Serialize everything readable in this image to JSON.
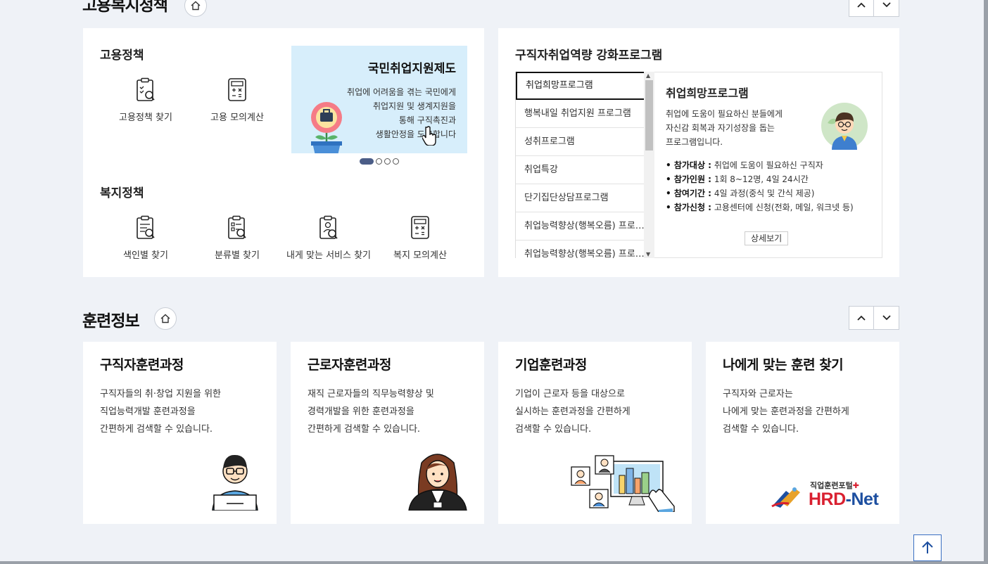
{
  "welfare_section": {
    "title": "고용복지정책",
    "employment": {
      "title": "고용정책",
      "items": [
        {
          "label": "고용정책 찾기",
          "icon": "clipboard-search-icon"
        },
        {
          "label": "고용 모의계산",
          "icon": "calculator-icon"
        }
      ],
      "banner": {
        "title": "국민취업지원제도",
        "lines": [
          "취업에 어려움을 겪는 국민에게",
          "취업지원 및 생계지원을",
          "통해 구직촉진과",
          "생활안정을 도모합니다"
        ],
        "slides": 4,
        "active_slide": 1
      }
    },
    "welfare": {
      "title": "복지정책",
      "items": [
        {
          "label": "색인별 찾기",
          "icon": "clipboard-list-icon"
        },
        {
          "label": "분류별 찾기",
          "icon": "clipboard-category-icon"
        },
        {
          "label": "내게 맞는 서비스 찾기",
          "icon": "person-search-icon"
        },
        {
          "label": "복지 모의계산",
          "icon": "calculator-icon"
        }
      ]
    },
    "programs": {
      "title": "구직자취업역량 강화프로그램",
      "list": [
        "취업희망프로그램",
        "행복내일 취업지원 프로그램",
        "성취프로그램",
        "취업특강",
        "단기집단상담프로그램",
        "취업능력향상(행복오름) 프로그램",
        "취업능력향상(행복오름) 프로그램"
      ],
      "active_index": 0,
      "detail": {
        "title": "취업희망프로그램",
        "desc_lines": [
          "취업에 도움이 필요하신 분들에게",
          "자신감 회복과 자기성장을 돕는",
          "프로그램입니다."
        ],
        "info": [
          {
            "label": "• 참가대상 :",
            "value": " 취업에 도움이 필요하신 구직자"
          },
          {
            "label": "• 참가인원 :",
            "value": " 1회 8~12명, 4일 24시간"
          },
          {
            "label": "• 참여기간 :",
            "value": " 4일 과정(중식 및 간식 제공)"
          },
          {
            "label": "• 참가신청 :",
            "value": " 고용센터에 신청(전화, 메일, 워크넷 등)"
          }
        ],
        "more_label": "상세보기"
      }
    }
  },
  "training_section": {
    "title": "훈련정보",
    "cards": [
      {
        "title": "구직자훈련과정",
        "lines": [
          "구직자들의 취·창업 지원을 위한",
          "직업능력개발 훈련과정을",
          "간편하게 검색할 수 있습니다."
        ]
      },
      {
        "title": "근로자훈련과정",
        "lines": [
          "재직 근로자들의 직무능력향상 및",
          "경력개발을 위한 훈련과정을",
          "간편하게 검색할 수 있습니다."
        ]
      },
      {
        "title": "기업훈련과정",
        "lines": [
          "기업이 근로자 등을 대상으로",
          "실시하는 훈련과정을 간편하게",
          "검색할 수 있습니다."
        ]
      },
      {
        "title": "나에게 맞는 훈련 찾기",
        "lines": [
          "구직자와 근로자는",
          "나에게 맞는 훈련과정을 간편하게",
          "검색할 수 있습니다."
        ]
      }
    ],
    "hrd_logo": {
      "small": "직업훈련포털",
      "main": "HRD",
      "suffix": "-Net"
    }
  },
  "colors": {
    "accent": "#4b5d87",
    "banner_bg": "#d7eefb",
    "page_bg": "#eff2f7",
    "hrd_red": "#d92030",
    "hrd_blue": "#1d4fa0"
  }
}
